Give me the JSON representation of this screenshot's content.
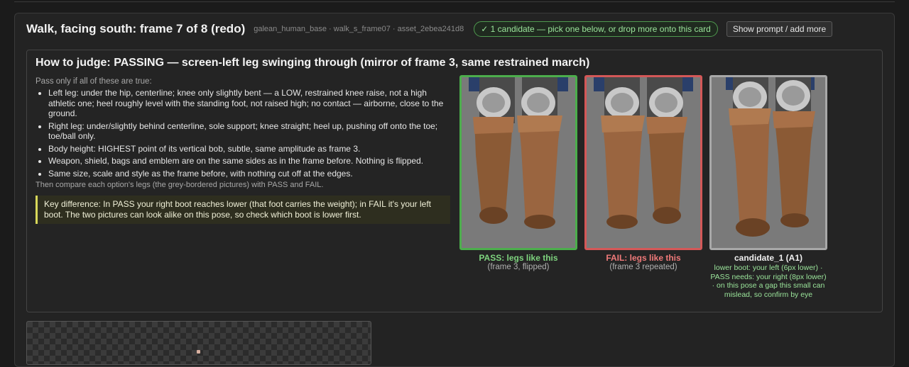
{
  "card": {
    "title": "Walk, facing south: frame 7 of 8 (redo)",
    "meta": "galean_human_base · walk_s_frame07 · asset_2ebea241d8",
    "status_pill": "✓ 1 candidate — pick one below, or drop more onto this card",
    "show_prompt_button": "Show prompt / add more"
  },
  "judge": {
    "title": "How to judge: PASSING — screen-left leg swinging through (mirror of frame 3, same restrained march)",
    "intro": "Pass only if all of these are true:",
    "criteria": [
      "Left leg: under the hip, centerline; knee only slightly bent — a LOW, restrained knee raise, not a high athletic one; heel roughly level with the standing foot, not raised high; no contact — airborne, close to the ground.",
      "Right leg: under/slightly behind centerline, sole support; knee straight; heel up, pushing off onto the toe; toe/ball only.",
      "Body height: HIGHEST point of its vertical bob, subtle, same amplitude as frame 3.",
      "Weapon, shield, bags and emblem are on the same sides as in the frame before. Nothing is flipped.",
      "Same size, scale and style as the frame before, with nothing cut off at the edges."
    ],
    "then": "Then compare each option's legs (the grey-bordered pictures) with PASS and FAIL.",
    "key_difference": "Key difference: In PASS your right boot reaches lower (that foot carries the weight); in FAIL it's your left boot. The two pictures can look alike on this pose, so check which boot is lower first."
  },
  "options": {
    "pass": {
      "caption": "PASS: legs like this",
      "sub": "(frame 3, flipped)",
      "color": "#4cae4c"
    },
    "fail": {
      "caption": "FAIL: legs like this",
      "sub": "(frame 3 repeated)",
      "color": "#d45858"
    },
    "candidate": {
      "caption": "candidate_1 (A1)",
      "note": "lower boot: your left (6px lower) · PASS needs: your right (8px lower) · on this pose a gap this small can mislead, so confirm by eye"
    }
  }
}
